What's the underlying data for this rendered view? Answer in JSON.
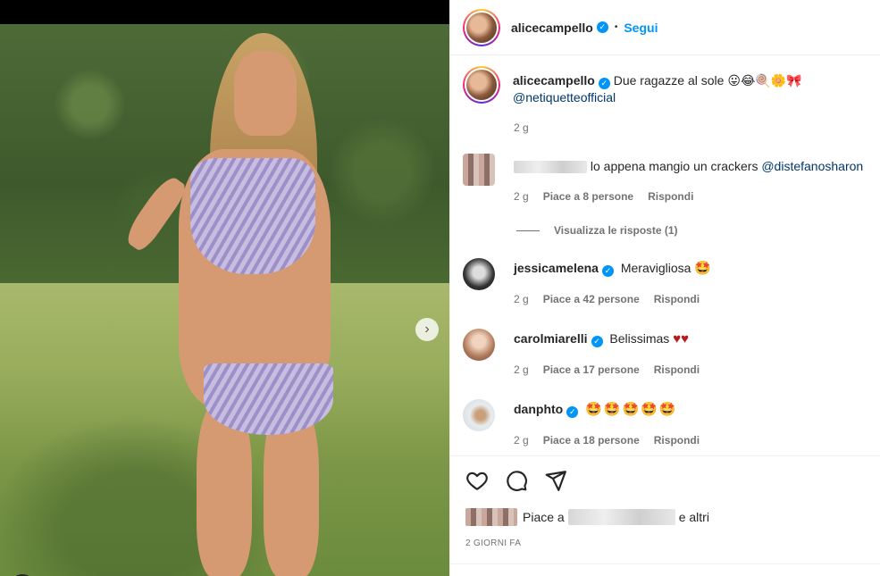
{
  "post": {
    "author": "alicecampello",
    "follow_label": "Segui",
    "caption": "Due ragazze al sole 😛😂🍭🌼🎀",
    "caption_mention": "@netiquetteofficial",
    "caption_time": "2 g"
  },
  "comments": [
    {
      "username": "",
      "text": "lo appena mangio un crackers",
      "mention": "@distefanosharon",
      "time": "2 g",
      "likes": "Piace a 8 persone",
      "reply": "Rispondi",
      "view_replies": "Visualizza le risposte (1)"
    },
    {
      "username": "jessicamelena",
      "text": "Meravigliosa",
      "emoji": "🤩",
      "time": "2 g",
      "likes": "Piace a 42 persone",
      "reply": "Rispondi"
    },
    {
      "username": "carolmiarelli",
      "text": "Belissimas",
      "emoji": "♥♥",
      "time": "2 g",
      "likes": "Piace a 17 persone",
      "reply": "Rispondi"
    },
    {
      "username": "danphto",
      "text": "",
      "emoji": "🤩🤩🤩🤩🤩",
      "time": "2 g",
      "likes": "Piace a 18 persone",
      "reply": "Rispondi"
    }
  ],
  "footer": {
    "likes_prefix": "Piace a",
    "likes_suffix": "e altri",
    "posted_ago": "2 GIORNI FA"
  },
  "icons": {
    "like": "heart-icon",
    "comment": "comment-icon",
    "share": "send-icon",
    "next": "chevron-right-icon",
    "tagged_user": "user-icon"
  },
  "colors": {
    "link": "#0095f6",
    "mention": "#00376b",
    "muted": "#737373",
    "text": "#262626"
  },
  "carousel": {
    "slide": 1,
    "slides": 2
  }
}
